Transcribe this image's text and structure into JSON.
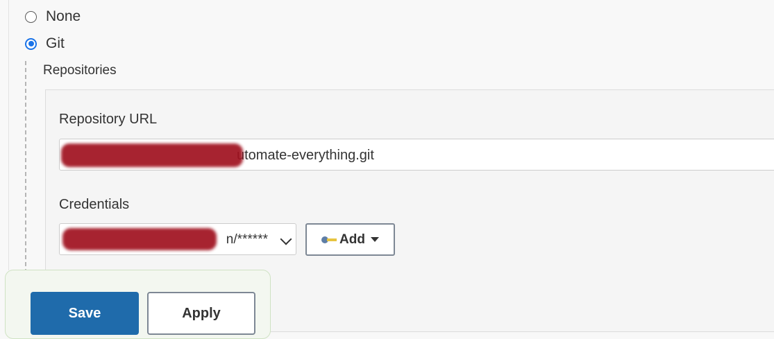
{
  "scm": {
    "options": [
      {
        "label": "None",
        "selected": false
      },
      {
        "label": "Git",
        "selected": true
      }
    ]
  },
  "git": {
    "section_title": "Repositories",
    "repository_url_label": "Repository URL",
    "repository_url_value": "utomate-everything.git",
    "credentials_label": "Credentials",
    "credentials_value": "n/******",
    "add_label": "Add",
    "key_icon": "key-icon"
  },
  "actions": {
    "save_label": "Save",
    "apply_label": "Apply"
  },
  "colors": {
    "accent": "#1a73e8",
    "save_button": "#1f6bab",
    "redaction": "#a0111f"
  }
}
